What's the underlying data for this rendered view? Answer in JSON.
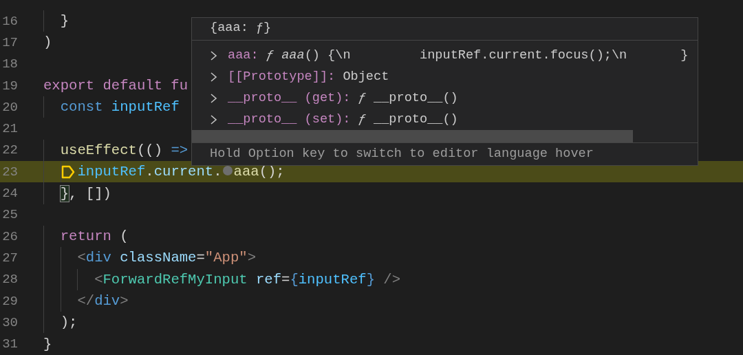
{
  "editor": {
    "lines": [
      {
        "number": "16",
        "current": false,
        "tokens": [
          {
            "text": "  }",
            "kind": "plain"
          }
        ]
      },
      {
        "number": "17",
        "current": false,
        "tokens": [
          {
            "text": ")",
            "kind": "plain"
          }
        ]
      },
      {
        "number": "18",
        "current": false
      },
      {
        "number": "19",
        "current": false,
        "tokens": [
          {
            "text": "export default fu",
            "kind": "keyword"
          }
        ]
      },
      {
        "number": "20",
        "current": false,
        "tokens": [
          {
            "text": "  const",
            "kind": "storage"
          },
          {
            "text": " inputRef",
            "kind": "constant"
          }
        ]
      },
      {
        "number": "21",
        "current": false
      },
      {
        "number": "22",
        "current": false,
        "tokens": [
          {
            "text": "  useEffect",
            "kind": "function"
          },
          {
            "text": "(() ",
            "kind": "plain"
          },
          {
            "text": "=>",
            "kind": "storage"
          }
        ]
      },
      {
        "number": "23",
        "current": true,
        "tokens": [
          {
            "text": "    inputRef",
            "kind": "constant"
          },
          {
            "text": ".",
            "kind": "plain"
          },
          {
            "text": "current",
            "kind": "variable"
          },
          {
            "text": ".",
            "kind": "plain"
          },
          {
            "text": "aaa",
            "kind": "function",
            "inline_breakpoint": true
          },
          {
            "text": "();",
            "kind": "plain"
          }
        ]
      },
      {
        "number": "24",
        "current": false,
        "tokens": [
          {
            "text": "  }",
            "kind": "bracket-match"
          },
          {
            "text": ", [])",
            "kind": "plain"
          }
        ]
      },
      {
        "number": "25",
        "current": false
      },
      {
        "number": "26",
        "current": false,
        "tokens": [
          {
            "text": "  return",
            "kind": "keyword"
          },
          {
            "text": " (",
            "kind": "plain"
          }
        ]
      },
      {
        "number": "27",
        "current": false,
        "tokens": [
          {
            "text": "    <",
            "kind": "bracket"
          },
          {
            "text": "div",
            "kind": "tag"
          },
          {
            "text": " className",
            "kind": "attribute"
          },
          {
            "text": "=",
            "kind": "plain"
          },
          {
            "text": "\"App\"",
            "kind": "string"
          },
          {
            "text": ">",
            "kind": "bracket"
          }
        ]
      },
      {
        "number": "28",
        "current": false,
        "tokens": [
          {
            "text": "      <",
            "kind": "bracket"
          },
          {
            "text": "ForwardRefMyInput",
            "kind": "component"
          },
          {
            "text": " ref",
            "kind": "attribute"
          },
          {
            "text": "=",
            "kind": "plain"
          },
          {
            "text": "{",
            "kind": "storage"
          },
          {
            "text": "inputRef",
            "kind": "constant"
          },
          {
            "text": "}",
            "kind": "storage"
          },
          {
            "text": " />",
            "kind": "bracket"
          }
        ]
      },
      {
        "number": "29",
        "current": false,
        "tokens": [
          {
            "text": "    </",
            "kind": "bracket"
          },
          {
            "text": "div",
            "kind": "tag"
          },
          {
            "text": ">",
            "kind": "bracket"
          }
        ]
      },
      {
        "number": "30",
        "current": false,
        "tokens": [
          {
            "text": "  );",
            "kind": "plain"
          }
        ]
      },
      {
        "number": "31",
        "current": false,
        "tokens": [
          {
            "text": "}",
            "kind": "plain"
          }
        ]
      }
    ]
  },
  "hover": {
    "title": "{aaa: ƒ}",
    "rows": [
      {
        "name": "aaa:",
        "expanded": false,
        "value": [
          {
            "text": "ƒ",
            "kind": "italic"
          },
          {
            "text": " aaa",
            "kind": "italic"
          },
          {
            "text": "() {\\n         inputRef.current.focus();\\n       }",
            "kind": "plain"
          }
        ]
      },
      {
        "name": "[[Prototype]]:",
        "expanded": false,
        "value": [
          {
            "text": "Object",
            "kind": "plain"
          }
        ]
      },
      {
        "name": "__proto__ (get):",
        "expanded": false,
        "value": [
          {
            "text": "ƒ",
            "kind": "italic"
          },
          {
            "text": " __proto__()",
            "kind": "plain"
          }
        ]
      },
      {
        "name": "__proto__ (set):",
        "expanded": false,
        "value": [
          {
            "text": "ƒ",
            "kind": "italic"
          },
          {
            "text": " __proto__()",
            "kind": "plain"
          }
        ]
      }
    ],
    "footer": "Hold Option key to switch to editor language hover"
  }
}
